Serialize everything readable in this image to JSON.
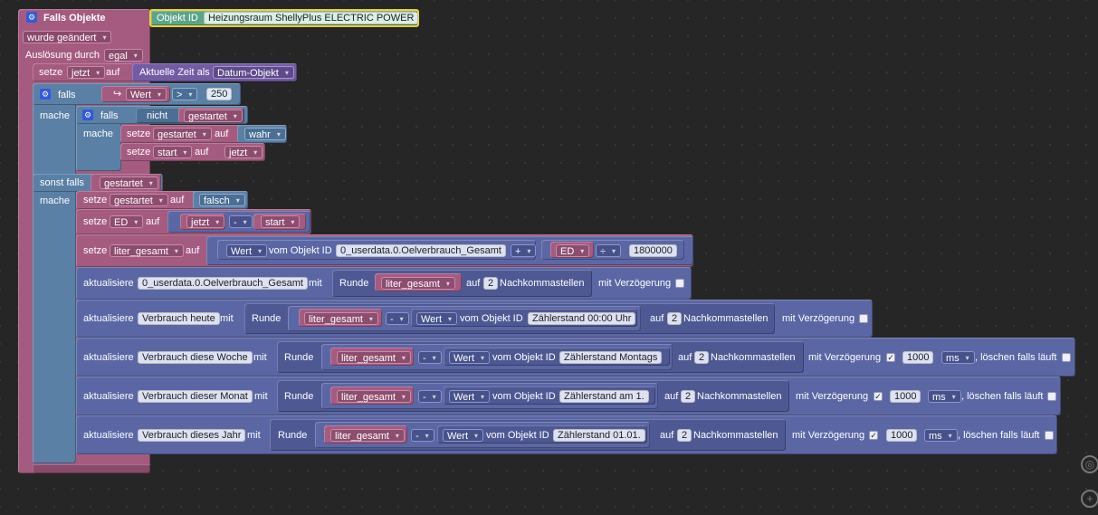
{
  "trigger": {
    "title": "Falls Objekte",
    "object_label": "Objekt ID",
    "object_value": "Heizungsraum ShellyPlus ELECTRIC POWER",
    "changed": "wurde geändert",
    "cause_label": "Auslösung durch",
    "cause_value": "egal"
  },
  "k": {
    "setze": "setze",
    "auf": "auf",
    "falls": "falls",
    "mache": "mache",
    "sonst_falls": "sonst falls",
    "nicht": "nicht",
    "aktualisiere": "aktualisiere",
    "mit": "mit",
    "runde": "Runde",
    "nachkomma": "Nachkommastellen",
    "mit_verz": "mit Verzögerung",
    "loeschen": ", löschen falls läuft",
    "wert": "Wert",
    "vom_objekt": "vom Objekt ID",
    "minus": "-",
    "plus": "+",
    "div": "÷",
    "gt": ">",
    "ms": "ms",
    "check": "✓"
  },
  "vars": {
    "jetzt": "jetzt",
    "gestartet": "gestartet",
    "start": "start",
    "ed": "ED",
    "liter": "liter_gesamt"
  },
  "values": {
    "aktuelle_zeit": "Aktuelle Zeit als",
    "datum_objekt": "Datum-Objekt",
    "threshold": "250",
    "wahr": "wahr",
    "falsch": "falsch",
    "oid_total": "0_userdata.0.Oelverbrauch_Gesamt",
    "divisor": "1800000",
    "digits": "2",
    "delay": "1000"
  },
  "targets": {
    "gesamt": "0_userdata.0.Oelverbrauch_Gesamt",
    "heute": "Verbrauch heute",
    "woche": "Verbrauch diese Woche",
    "monat": "Verbrauch dieser Monat",
    "jahr": "Verbrauch dieses Jahr"
  },
  "sources": {
    "heute": "Zählerstand 00:00 Uhr",
    "woche": "Zählerstand Montags",
    "monat": "Zählerstand am 1.",
    "jahr": "Zählerstand 01.01."
  },
  "colors": {
    "trigger": "#a55b80",
    "logic": "#5b80a5",
    "variable": "#a55b80",
    "io": "#5b67a5",
    "time": "#745ba5",
    "object": "#5ba58c"
  },
  "icons": [
    "gear-icon",
    "return-arrow-icon",
    "zoom-center-icon",
    "zoom-in-icon"
  ]
}
